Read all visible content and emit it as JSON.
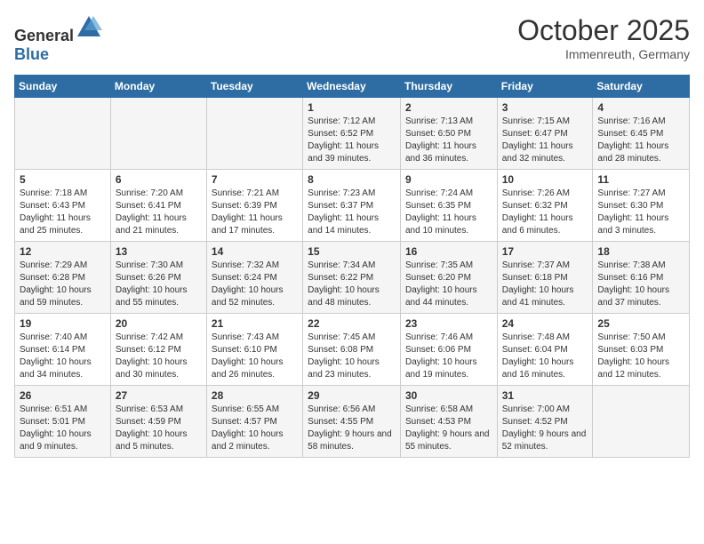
{
  "header": {
    "logo_general": "General",
    "logo_blue": "Blue",
    "month": "October 2025",
    "location": "Immenreuth, Germany"
  },
  "weekdays": [
    "Sunday",
    "Monday",
    "Tuesday",
    "Wednesday",
    "Thursday",
    "Friday",
    "Saturday"
  ],
  "weeks": [
    [
      {
        "day": "",
        "info": ""
      },
      {
        "day": "",
        "info": ""
      },
      {
        "day": "",
        "info": ""
      },
      {
        "day": "1",
        "info": "Sunrise: 7:12 AM\nSunset: 6:52 PM\nDaylight: 11 hours and 39 minutes."
      },
      {
        "day": "2",
        "info": "Sunrise: 7:13 AM\nSunset: 6:50 PM\nDaylight: 11 hours and 36 minutes."
      },
      {
        "day": "3",
        "info": "Sunrise: 7:15 AM\nSunset: 6:47 PM\nDaylight: 11 hours and 32 minutes."
      },
      {
        "day": "4",
        "info": "Sunrise: 7:16 AM\nSunset: 6:45 PM\nDaylight: 11 hours and 28 minutes."
      }
    ],
    [
      {
        "day": "5",
        "info": "Sunrise: 7:18 AM\nSunset: 6:43 PM\nDaylight: 11 hours and 25 minutes."
      },
      {
        "day": "6",
        "info": "Sunrise: 7:20 AM\nSunset: 6:41 PM\nDaylight: 11 hours and 21 minutes."
      },
      {
        "day": "7",
        "info": "Sunrise: 7:21 AM\nSunset: 6:39 PM\nDaylight: 11 hours and 17 minutes."
      },
      {
        "day": "8",
        "info": "Sunrise: 7:23 AM\nSunset: 6:37 PM\nDaylight: 11 hours and 14 minutes."
      },
      {
        "day": "9",
        "info": "Sunrise: 7:24 AM\nSunset: 6:35 PM\nDaylight: 11 hours and 10 minutes."
      },
      {
        "day": "10",
        "info": "Sunrise: 7:26 AM\nSunset: 6:32 PM\nDaylight: 11 hours and 6 minutes."
      },
      {
        "day": "11",
        "info": "Sunrise: 7:27 AM\nSunset: 6:30 PM\nDaylight: 11 hours and 3 minutes."
      }
    ],
    [
      {
        "day": "12",
        "info": "Sunrise: 7:29 AM\nSunset: 6:28 PM\nDaylight: 10 hours and 59 minutes."
      },
      {
        "day": "13",
        "info": "Sunrise: 7:30 AM\nSunset: 6:26 PM\nDaylight: 10 hours and 55 minutes."
      },
      {
        "day": "14",
        "info": "Sunrise: 7:32 AM\nSunset: 6:24 PM\nDaylight: 10 hours and 52 minutes."
      },
      {
        "day": "15",
        "info": "Sunrise: 7:34 AM\nSunset: 6:22 PM\nDaylight: 10 hours and 48 minutes."
      },
      {
        "day": "16",
        "info": "Sunrise: 7:35 AM\nSunset: 6:20 PM\nDaylight: 10 hours and 44 minutes."
      },
      {
        "day": "17",
        "info": "Sunrise: 7:37 AM\nSunset: 6:18 PM\nDaylight: 10 hours and 41 minutes."
      },
      {
        "day": "18",
        "info": "Sunrise: 7:38 AM\nSunset: 6:16 PM\nDaylight: 10 hours and 37 minutes."
      }
    ],
    [
      {
        "day": "19",
        "info": "Sunrise: 7:40 AM\nSunset: 6:14 PM\nDaylight: 10 hours and 34 minutes."
      },
      {
        "day": "20",
        "info": "Sunrise: 7:42 AM\nSunset: 6:12 PM\nDaylight: 10 hours and 30 minutes."
      },
      {
        "day": "21",
        "info": "Sunrise: 7:43 AM\nSunset: 6:10 PM\nDaylight: 10 hours and 26 minutes."
      },
      {
        "day": "22",
        "info": "Sunrise: 7:45 AM\nSunset: 6:08 PM\nDaylight: 10 hours and 23 minutes."
      },
      {
        "day": "23",
        "info": "Sunrise: 7:46 AM\nSunset: 6:06 PM\nDaylight: 10 hours and 19 minutes."
      },
      {
        "day": "24",
        "info": "Sunrise: 7:48 AM\nSunset: 6:04 PM\nDaylight: 10 hours and 16 minutes."
      },
      {
        "day": "25",
        "info": "Sunrise: 7:50 AM\nSunset: 6:03 PM\nDaylight: 10 hours and 12 minutes."
      }
    ],
    [
      {
        "day": "26",
        "info": "Sunrise: 6:51 AM\nSunset: 5:01 PM\nDaylight: 10 hours and 9 minutes."
      },
      {
        "day": "27",
        "info": "Sunrise: 6:53 AM\nSunset: 4:59 PM\nDaylight: 10 hours and 5 minutes."
      },
      {
        "day": "28",
        "info": "Sunrise: 6:55 AM\nSunset: 4:57 PM\nDaylight: 10 hours and 2 minutes."
      },
      {
        "day": "29",
        "info": "Sunrise: 6:56 AM\nSunset: 4:55 PM\nDaylight: 9 hours and 58 minutes."
      },
      {
        "day": "30",
        "info": "Sunrise: 6:58 AM\nSunset: 4:53 PM\nDaylight: 9 hours and 55 minutes."
      },
      {
        "day": "31",
        "info": "Sunrise: 7:00 AM\nSunset: 4:52 PM\nDaylight: 9 hours and 52 minutes."
      },
      {
        "day": "",
        "info": ""
      }
    ]
  ]
}
